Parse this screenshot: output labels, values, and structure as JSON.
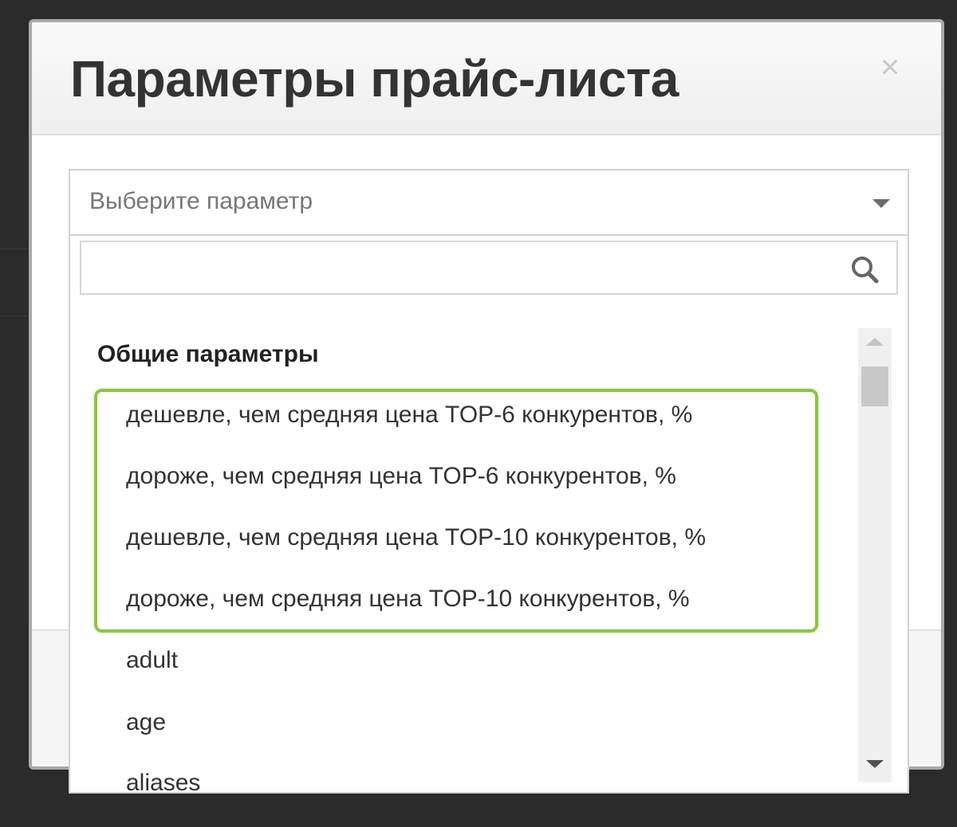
{
  "modal": {
    "title": "Параметры прайс-листа",
    "close_label": "×"
  },
  "select": {
    "placeholder": "Выберите параметр"
  },
  "search": {
    "value": "",
    "placeholder": ""
  },
  "dropdown": {
    "group_label": "Общие параметры",
    "options": [
      "дешевле, чем средняя цена TOP-6 конкурентов, %",
      "дороже, чем средняя цена TOP-6 конкурентов, %",
      "дешевле, чем средняя цена TOP-10 конкурентов, %",
      "дороже, чем средняя цена TOP-10 конкурентов, %",
      "adult",
      "age",
      "aliases"
    ]
  },
  "colors": {
    "highlight": "#8cc63f",
    "backdrop": "#2b2b2b"
  },
  "icons": {
    "search": "search-icon",
    "close": "close-icon",
    "dropdown_arrow": "chevron-down-icon"
  }
}
